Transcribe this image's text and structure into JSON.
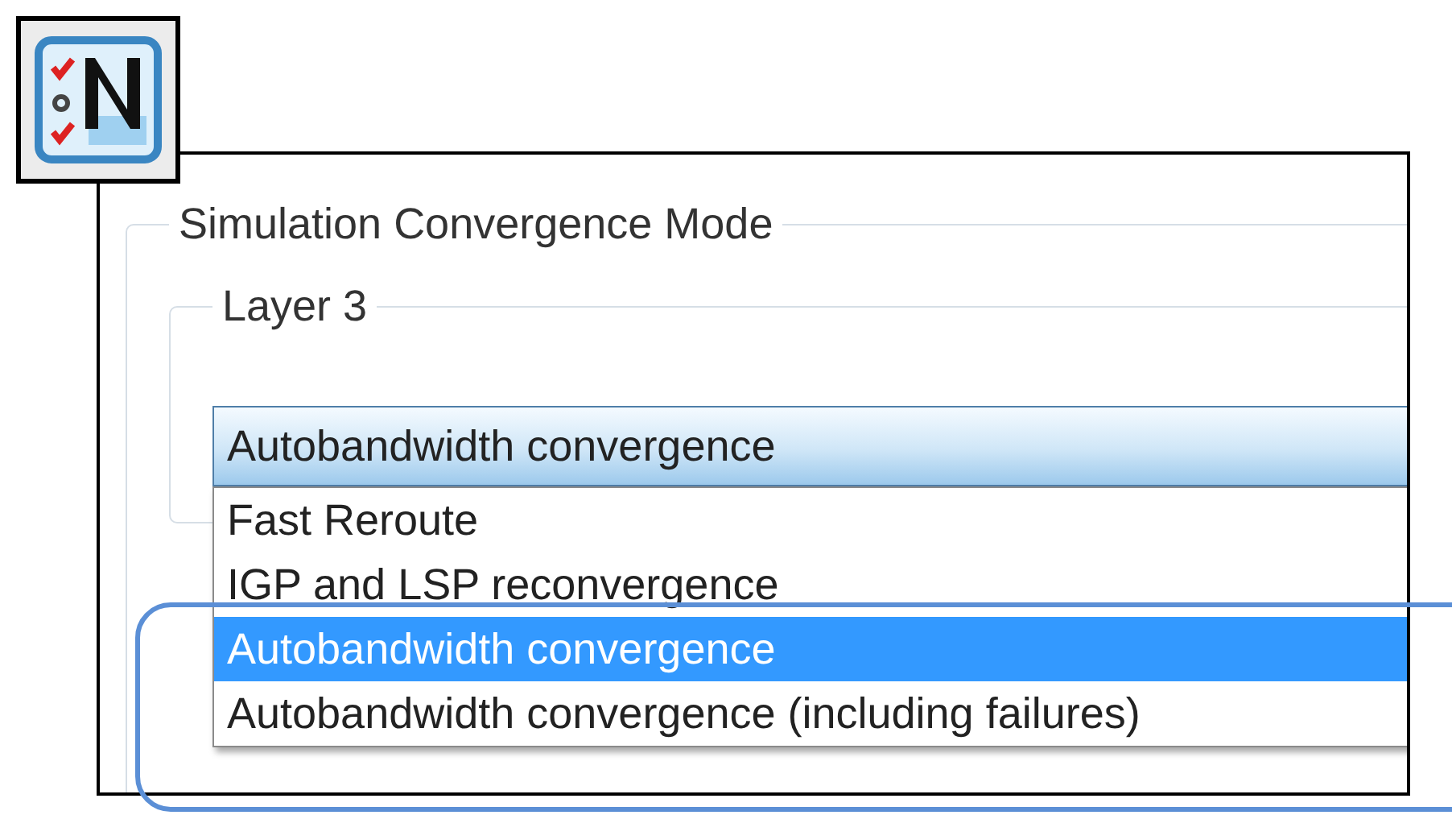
{
  "group": {
    "title": "Simulation Convergence Mode",
    "subgroup": {
      "title": "Layer 3",
      "select": {
        "value": "Autobandwidth convergence",
        "expanded": true,
        "options": [
          {
            "label": "Fast Reroute",
            "selected": false
          },
          {
            "label": "IGP and LSP reconvergence",
            "selected": false
          },
          {
            "label": "Autobandwidth convergence",
            "selected": true
          },
          {
            "label": "Autobandwidth convergence (including failures)",
            "selected": false
          }
        ]
      }
    }
  }
}
